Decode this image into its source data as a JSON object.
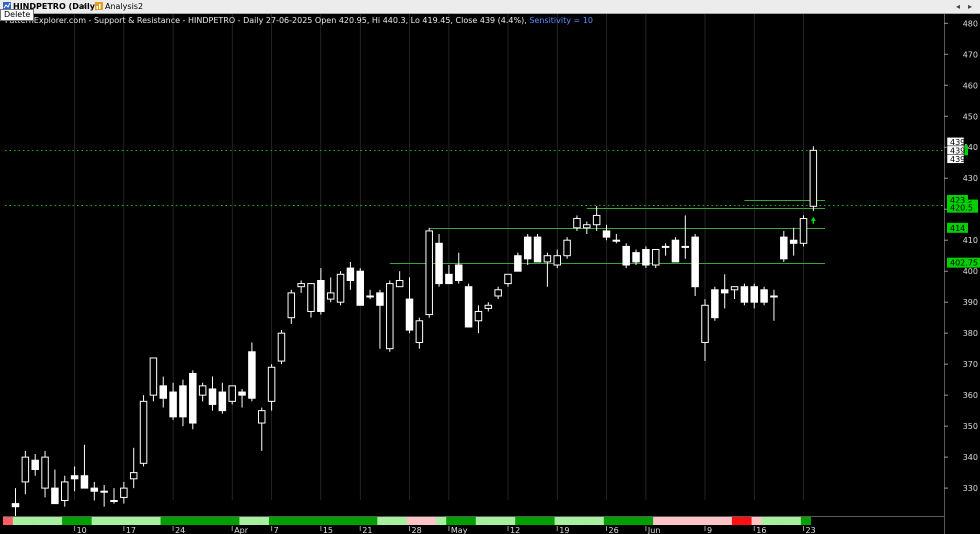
{
  "tabs": [
    {
      "label": "HINDPETRO (Daily)",
      "active": true,
      "icon": "chart-icon"
    },
    {
      "label": "Analysis2",
      "active": false,
      "icon": "analysis-icon"
    }
  ],
  "tooltip": "Delete",
  "title": {
    "text": "PatternExplorer.com - Support & Resistance - HINDPETRO - Daily 27-06-2025 Open 420.95, Hi 440.3, Lo 419.45, Close 439 (4.4%)",
    "sensitivity": "Sensitivity = 10"
  },
  "chart_data": {
    "type": "candlestick",
    "symbol": "HINDPETRO",
    "interval": "Daily",
    "ylim": [
      321,
      483
    ],
    "y_ticks": [
      330,
      340,
      350,
      360,
      370,
      380,
      390,
      400,
      410,
      420,
      430,
      440,
      450,
      460,
      470,
      480
    ],
    "x_ticks": [
      {
        "label": "10",
        "i": 6
      },
      {
        "label": "17",
        "i": 11
      },
      {
        "label": "24",
        "i": 16
      },
      {
        "label": "Apr",
        "i": 22
      },
      {
        "label": "7",
        "i": 26
      },
      {
        "label": "15",
        "i": 31
      },
      {
        "label": "21",
        "i": 35
      },
      {
        "label": "28",
        "i": 40
      },
      {
        "label": "May",
        "i": 44
      },
      {
        "label": "12",
        "i": 50
      },
      {
        "label": "19",
        "i": 55
      },
      {
        "label": "26",
        "i": 60
      },
      {
        "label": "Jun",
        "i": 64
      },
      {
        "label": "9",
        "i": 70
      },
      {
        "label": "16",
        "i": 75
      },
      {
        "label": "23",
        "i": 80
      }
    ],
    "candles": [
      {
        "o": 325,
        "h": 330,
        "l": 321,
        "c": 324
      },
      {
        "o": 332,
        "h": 342,
        "l": 328,
        "c": 340
      },
      {
        "o": 339,
        "h": 341,
        "l": 334,
        "c": 336
      },
      {
        "o": 330,
        "h": 342,
        "l": 327,
        "c": 340
      },
      {
        "o": 330,
        "h": 336,
        "l": 325,
        "c": 325
      },
      {
        "o": 326,
        "h": 334,
        "l": 324,
        "c": 332
      },
      {
        "o": 334,
        "h": 337,
        "l": 329,
        "c": 333
      },
      {
        "o": 334,
        "h": 344,
        "l": 330,
        "c": 330
      },
      {
        "o": 330,
        "h": 332,
        "l": 326,
        "c": 329
      },
      {
        "o": 329,
        "h": 331,
        "l": 324,
        "c": 329
      },
      {
        "o": 326,
        "h": 330,
        "l": 325,
        "c": 326
      },
      {
        "o": 327,
        "h": 332,
        "l": 325,
        "c": 330
      },
      {
        "o": 333,
        "h": 343,
        "l": 330,
        "c": 335
      },
      {
        "o": 338,
        "h": 360,
        "l": 337,
        "c": 358
      },
      {
        "o": 360,
        "h": 372,
        "l": 358,
        "c": 372
      },
      {
        "o": 363,
        "h": 366,
        "l": 356,
        "c": 359
      },
      {
        "o": 361,
        "h": 364,
        "l": 352,
        "c": 353
      },
      {
        "o": 363,
        "h": 365,
        "l": 350,
        "c": 353
      },
      {
        "o": 367,
        "h": 368,
        "l": 349,
        "c": 351
      },
      {
        "o": 360,
        "h": 364,
        "l": 358,
        "c": 363
      },
      {
        "o": 362,
        "h": 366,
        "l": 355,
        "c": 357
      },
      {
        "o": 361,
        "h": 364,
        "l": 354,
        "c": 355
      },
      {
        "o": 358,
        "h": 363,
        "l": 357,
        "c": 363
      },
      {
        "o": 361,
        "h": 362,
        "l": 356,
        "c": 360
      },
      {
        "o": 374,
        "h": 377,
        "l": 358,
        "c": 359
      },
      {
        "o": 351,
        "h": 356,
        "l": 342,
        "c": 355
      },
      {
        "o": 358,
        "h": 370,
        "l": 355,
        "c": 369
      },
      {
        "o": 371,
        "h": 381,
        "l": 370,
        "c": 380
      },
      {
        "o": 385,
        "h": 394,
        "l": 383,
        "c": 393
      },
      {
        "o": 395,
        "h": 397,
        "l": 393,
        "c": 396
      },
      {
        "o": 387,
        "h": 396,
        "l": 385,
        "c": 396
      },
      {
        "o": 397,
        "h": 401,
        "l": 386,
        "c": 387
      },
      {
        "o": 391,
        "h": 398,
        "l": 390,
        "c": 393
      },
      {
        "o": 390,
        "h": 400,
        "l": 389,
        "c": 399
      },
      {
        "o": 401,
        "h": 403,
        "l": 394,
        "c": 397
      },
      {
        "o": 400,
        "h": 401,
        "l": 389,
        "c": 389
      },
      {
        "o": 392,
        "h": 394,
        "l": 391,
        "c": 392
      },
      {
        "o": 393,
        "h": 394,
        "l": 375,
        "c": 389
      },
      {
        "o": 375,
        "h": 397,
        "l": 374,
        "c": 396
      },
      {
        "o": 395,
        "h": 400,
        "l": 395,
        "c": 397
      },
      {
        "o": 391,
        "h": 398,
        "l": 380,
        "c": 381
      },
      {
        "o": 377,
        "h": 385,
        "l": 375,
        "c": 384
      },
      {
        "o": 386,
        "h": 414,
        "l": 385,
        "c": 413
      },
      {
        "o": 409,
        "h": 412,
        "l": 395,
        "c": 396
      },
      {
        "o": 399,
        "h": 402,
        "l": 396,
        "c": 396
      },
      {
        "o": 402,
        "h": 406,
        "l": 396,
        "c": 397
      },
      {
        "o": 395,
        "h": 396,
        "l": 382,
        "c": 382
      },
      {
        "o": 384,
        "h": 389,
        "l": 380,
        "c": 387
      },
      {
        "o": 388,
        "h": 390,
        "l": 387,
        "c": 389
      },
      {
        "o": 392,
        "h": 395,
        "l": 391,
        "c": 394
      },
      {
        "o": 396,
        "h": 399,
        "l": 395,
        "c": 399
      },
      {
        "o": 405,
        "h": 406,
        "l": 400,
        "c": 400
      },
      {
        "o": 411,
        "h": 412,
        "l": 402,
        "c": 404
      },
      {
        "o": 411,
        "h": 412,
        "l": 403,
        "c": 403
      },
      {
        "o": 403,
        "h": 406,
        "l": 395,
        "c": 405
      },
      {
        "o": 402,
        "h": 407,
        "l": 401,
        "c": 405
      },
      {
        "o": 405,
        "h": 411,
        "l": 404,
        "c": 410
      },
      {
        "o": 414,
        "h": 418,
        "l": 413,
        "c": 417
      },
      {
        "o": 414,
        "h": 416,
        "l": 412,
        "c": 415
      },
      {
        "o": 415,
        "h": 421,
        "l": 413,
        "c": 418
      },
      {
        "o": 413,
        "h": 415,
        "l": 410,
        "c": 411
      },
      {
        "o": 410,
        "h": 412,
        "l": 409,
        "c": 410
      },
      {
        "o": 408,
        "h": 409,
        "l": 401,
        "c": 402
      },
      {
        "o": 406,
        "h": 407,
        "l": 402,
        "c": 403
      },
      {
        "o": 407,
        "h": 408,
        "l": 401,
        "c": 402
      },
      {
        "o": 402,
        "h": 407,
        "l": 401,
        "c": 407
      },
      {
        "o": 408,
        "h": 409,
        "l": 405,
        "c": 408
      },
      {
        "o": 410,
        "h": 411,
        "l": 403,
        "c": 403
      },
      {
        "o": 408,
        "h": 418,
        "l": 404,
        "c": 408
      },
      {
        "o": 411,
        "h": 412,
        "l": 392,
        "c": 395
      },
      {
        "o": 377,
        "h": 391,
        "l": 371,
        "c": 389
      },
      {
        "o": 394,
        "h": 395,
        "l": 384,
        "c": 385
      },
      {
        "o": 394,
        "h": 399,
        "l": 388,
        "c": 393
      },
      {
        "o": 394,
        "h": 395,
        "l": 391,
        "c": 395
      },
      {
        "o": 395,
        "h": 396,
        "l": 389,
        "c": 390
      },
      {
        "o": 395,
        "h": 396,
        "l": 388,
        "c": 390
      },
      {
        "o": 394,
        "h": 395,
        "l": 389,
        "c": 390
      },
      {
        "o": 392,
        "h": 394,
        "l": 384,
        "c": 392
      },
      {
        "o": 411,
        "h": 413,
        "l": 403,
        "c": 404
      },
      {
        "o": 410,
        "h": 414,
        "l": 405,
        "c": 409
      },
      {
        "o": 409,
        "h": 418,
        "l": 408,
        "c": 417
      },
      {
        "o": 420.95,
        "h": 440.3,
        "l": 419.45,
        "c": 439
      }
    ],
    "sr_levels": [
      {
        "price": 439,
        "label": "439",
        "style": "dotted",
        "color": "#00c000",
        "from_i": -2
      },
      {
        "price": 421.5,
        "label": "421.5",
        "style": "dotted",
        "color": "#00c000",
        "from_i": -2
      },
      {
        "price": 423,
        "label": "423",
        "style": "solid",
        "color": "#3aa53a",
        "from_i": 74
      },
      {
        "price": 420.5,
        "label": "420.5",
        "style": "solid",
        "color": "#3aa53a",
        "from_i": 58
      },
      {
        "price": 414,
        "label": "414",
        "style": "solid",
        "color": "#3aa53a",
        "from_i": 42
      },
      {
        "price": 402.75,
        "label": "402.75",
        "style": "solid",
        "color": "#3aa53a",
        "from_i": 38
      }
    ],
    "last_price_labels": [
      "439",
      "439",
      "439"
    ],
    "band": [
      "#ff5c64",
      "#a8f0a0",
      "#a8f0a0",
      "#a8f0a0",
      "#a8f0a0",
      "#a8f0a0",
      "#00a000",
      "#00a000",
      "#00a000",
      "#a8f0a0",
      "#a8f0a0",
      "#a8f0a0",
      "#a8f0a0",
      "#a8f0a0",
      "#a8f0a0",
      "#a8f0a0",
      "#00a000",
      "#00a000",
      "#00a000",
      "#00a000",
      "#00a000",
      "#00a000",
      "#00a000",
      "#00a000",
      "#a8f0a0",
      "#a8f0a0",
      "#a8f0a0",
      "#00a000",
      "#00a000",
      "#00a000",
      "#00a000",
      "#00a000",
      "#00a000",
      "#00a000",
      "#00a000",
      "#00a000",
      "#00a000",
      "#00a000",
      "#a8f0a0",
      "#a8f0a0",
      "#a8f0a0",
      "#ffc4c8",
      "#ffc4c8",
      "#ffc4c8",
      "#a8f0a0",
      "#00a000",
      "#00a000",
      "#00a000",
      "#a8f0a0",
      "#a8f0a0",
      "#a8f0a0",
      "#a8f0a0",
      "#00a000",
      "#00a000",
      "#00a000",
      "#00a000",
      "#a8f0a0",
      "#a8f0a0",
      "#a8f0a0",
      "#a8f0a0",
      "#a8f0a0",
      "#00a000",
      "#00a000",
      "#00a000",
      "#00a000",
      "#00a000",
      "#ffc4c8",
      "#ffc4c8",
      "#ffc4c8",
      "#ffc4c8",
      "#ffc4c8",
      "#ffc4c8",
      "#ffc4c8",
      "#ffc4c8",
      "#ff1010",
      "#ff1010",
      "#ffc4c8",
      "#a8f0a0",
      "#a8f0a0",
      "#a8f0a0",
      "#a8f0a0",
      "#00a000"
    ]
  },
  "colors": {
    "background": "#000000",
    "candle": "#ffffff",
    "grid": "#3a3a3a",
    "support_line": "#3aa53a",
    "dotted_line": "#00c000",
    "label_green": "#00d000",
    "label_last": "#ffffff",
    "arrow": "#00e000",
    "sensitivity_text": "#5a8cff"
  }
}
